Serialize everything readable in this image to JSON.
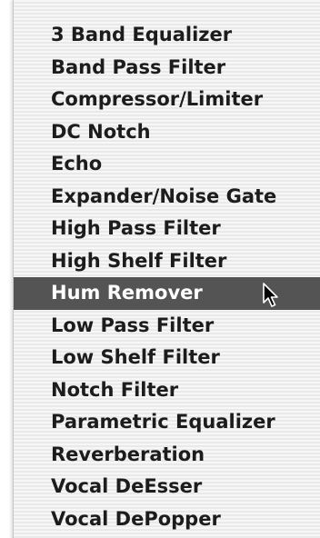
{
  "menu": {
    "items": [
      {
        "label": "3 Band Equalizer"
      },
      {
        "label": "Band Pass Filter"
      },
      {
        "label": "Compressor/Limiter"
      },
      {
        "label": "DC Notch"
      },
      {
        "label": "Echo"
      },
      {
        "label": "Expander/Noise Gate"
      },
      {
        "label": "High Pass Filter"
      },
      {
        "label": "High Shelf Filter"
      },
      {
        "label": "Hum Remover",
        "selected": true
      },
      {
        "label": "Low Pass Filter"
      },
      {
        "label": "Low Shelf Filter"
      },
      {
        "label": "Notch Filter"
      },
      {
        "label": "Parametric Equalizer"
      },
      {
        "label": "Reverberation"
      },
      {
        "label": "Vocal DeEsser"
      },
      {
        "label": "Vocal DePopper"
      }
    ],
    "selected_index": 8
  },
  "colors": {
    "highlight": "#545454",
    "text": "#1c1c1c",
    "highlight_text": "#ffffff"
  },
  "icons": {
    "cursor": "mouse-pointer-arrow-icon"
  }
}
